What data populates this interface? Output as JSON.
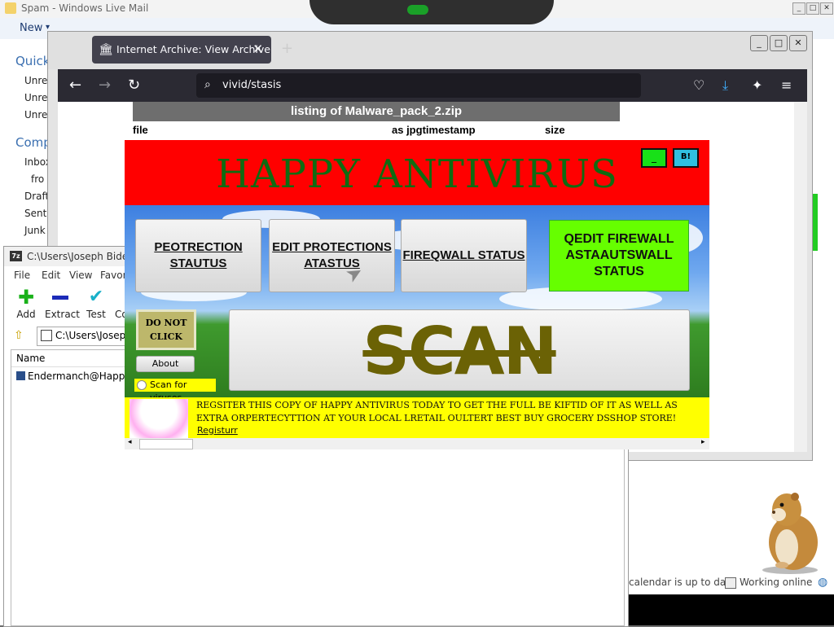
{
  "mail": {
    "title": "Spam - Windows Live Mail",
    "new_label": "New",
    "sidebar": {
      "quick_header": "Quick",
      "quick_items": [
        "Unrea",
        "Unrea",
        "Unrea"
      ],
      "comp_header": "Comp",
      "comp_items": [
        "Inbox",
        "fro",
        "Draft",
        "Sent",
        "Junk"
      ]
    },
    "status_text": "calendar is up to date",
    "status_online": "Working online"
  },
  "browser": {
    "tab_title": "Internet Archive: View Archive",
    "url": "vivid/stasis",
    "listing_title": "listing of Malware_pack_2.zip",
    "columns": {
      "file": "file",
      "as_jpg_timestamp": "as jpgtimestamp",
      "size": "size"
    }
  },
  "zip": {
    "title": "C:\\Users\\Joseph Biden\\",
    "menu": [
      "File",
      "Edit",
      "View",
      "Favor"
    ],
    "tools": [
      "Add",
      "Extract",
      "Test",
      "Co"
    ],
    "path": "C:\\Users\\Joseph",
    "column_name": "Name",
    "row": "Endermanch@HappyA"
  },
  "antivirus": {
    "title": "HAPPY ANTIVIRUS",
    "min_label": "_",
    "close_label": "B!",
    "buttons": {
      "protection": "PEOTRECTION STAUTUS",
      "edit": "EDIT PROTECTIONS ATASTUS",
      "firewall": "FIREQWALL STATUS",
      "firewall_green": "QEDIT FIREWALL ASTAAUTSWALL STATUS"
    },
    "do_not_click": "DO NOT CLICK",
    "about": "About",
    "scan_viruses": "Scan for viruses",
    "scan": "SCAN",
    "register_text": "REGSITER THIS COPY OF HAPPY ANTIVIRUS TODAY TO GET THE FULL BE KIFTID OF IT AS WELL AS EXTRA ORPERTECYTTION AT YOUR LOCAL LRETAIL OULTERT BEST BUY GROCERY DSSHOP STORE!",
    "register_link": "Registurr"
  },
  "colors": {
    "red": "#ff0000",
    "title_green": "#0f6b12",
    "firewall_green": "#66ff00",
    "yellow": "#ffff00",
    "scan_olive": "#6b6205"
  }
}
